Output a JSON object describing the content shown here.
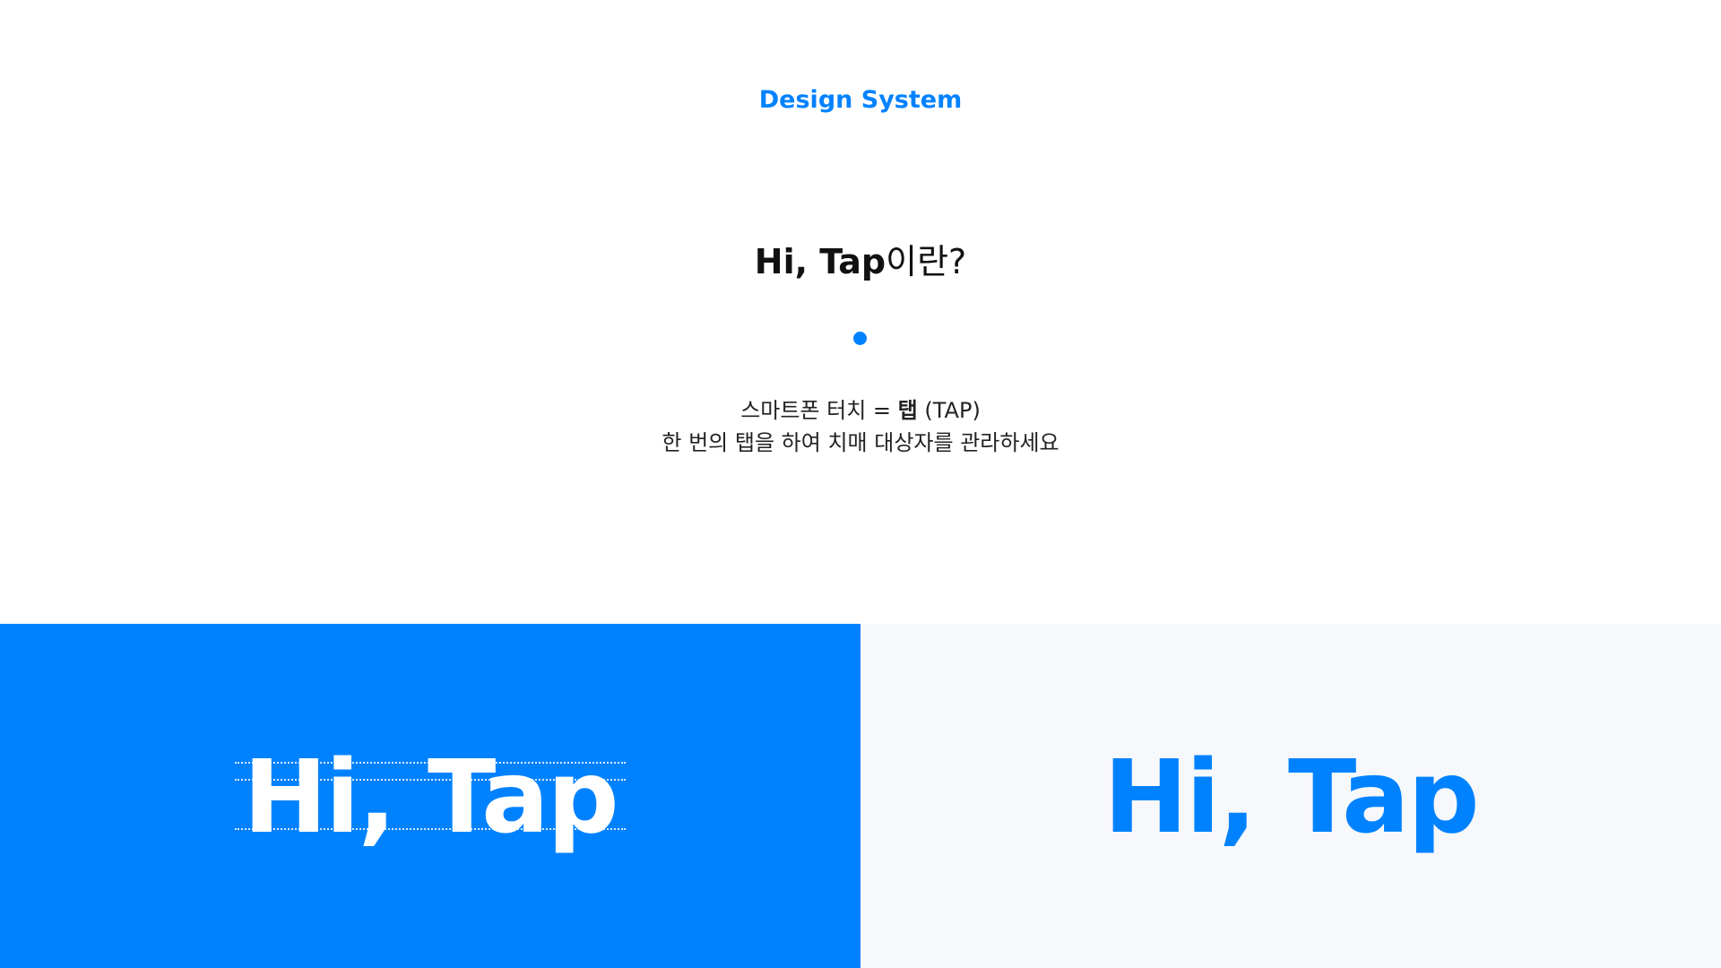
{
  "header": {
    "eyebrow": "Design System"
  },
  "intro": {
    "title_brand": "Hi, Tap",
    "title_suffix": "이란?",
    "line1_prefix": "스마트폰 터치 = ",
    "line1_strong": "탭",
    "line1_suffix": " (TAP)",
    "line2": "한 번의 탭을 하여 치매 대상자를 관라하세요"
  },
  "panels": {
    "left_logo": "Hi, Tap",
    "right_logo": "Hi, Tap"
  },
  "colors": {
    "primary": "#0082ff",
    "light_bg": "#f6f8fb",
    "text": "#111111"
  }
}
